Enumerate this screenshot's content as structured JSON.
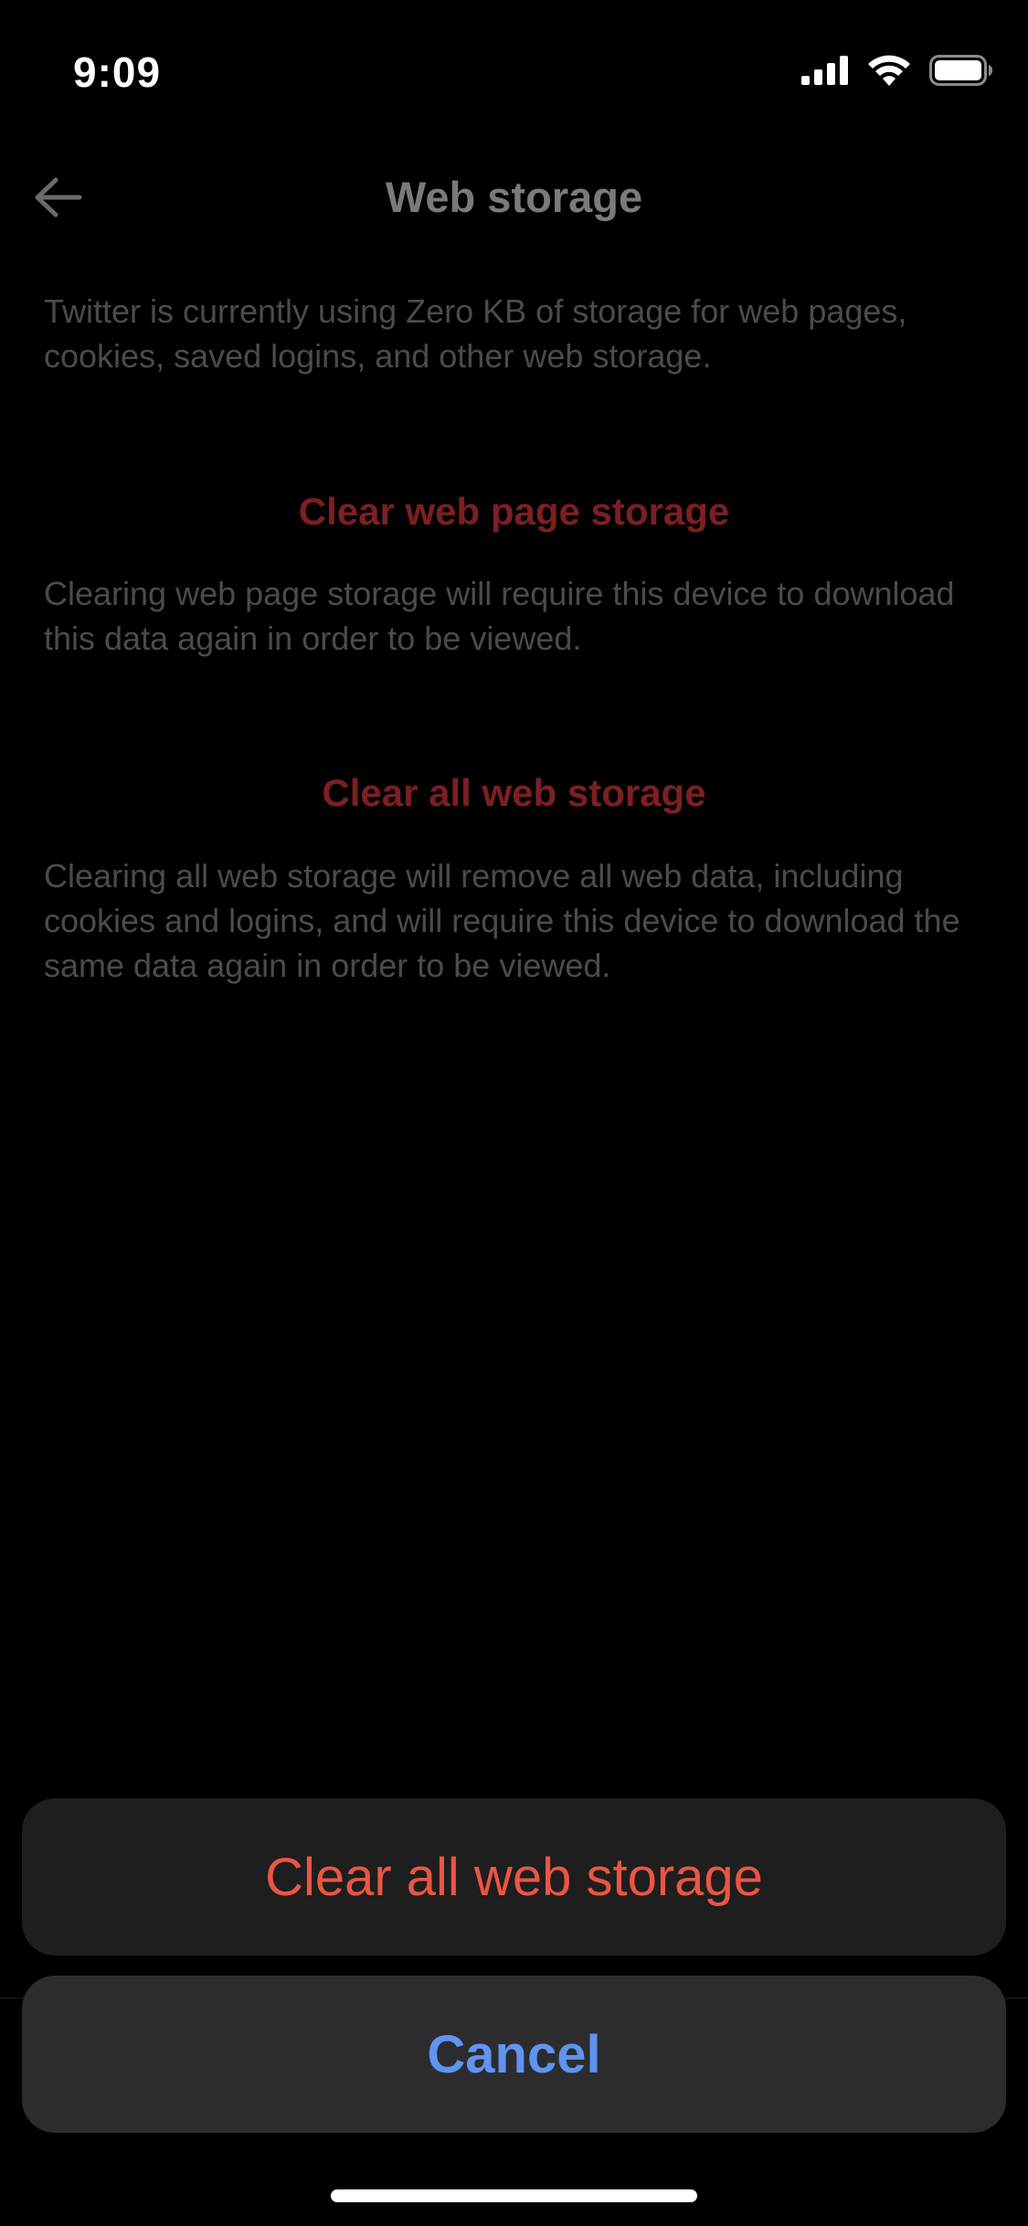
{
  "status_bar": {
    "time": "9:09",
    "icons": [
      "cellular-signal-icon",
      "wifi-icon",
      "battery-icon"
    ]
  },
  "nav": {
    "back_icon": "arrow-left-icon",
    "title": "Web storage"
  },
  "content": {
    "usage_description": "Twitter is currently using Zero KB of storage for web pages, cookies, saved logins, and other web storage.",
    "clear_page_label": "Clear web page storage",
    "clear_page_description": "Clearing web page storage will require this device to download this data again in order to be viewed.",
    "clear_all_label": "Clear all web storage",
    "clear_all_description": "Clearing all web storage will remove all web data, including cookies and logins, and will require this device to download the same data again in order to be viewed."
  },
  "action_sheet": {
    "destructive_label": "Clear all web storage",
    "cancel_label": "Cancel"
  },
  "colors": {
    "background": "#000000",
    "destructive": "#eb5545",
    "cancel": "#5f94f0",
    "dimmed_link": "#7d1f22"
  }
}
